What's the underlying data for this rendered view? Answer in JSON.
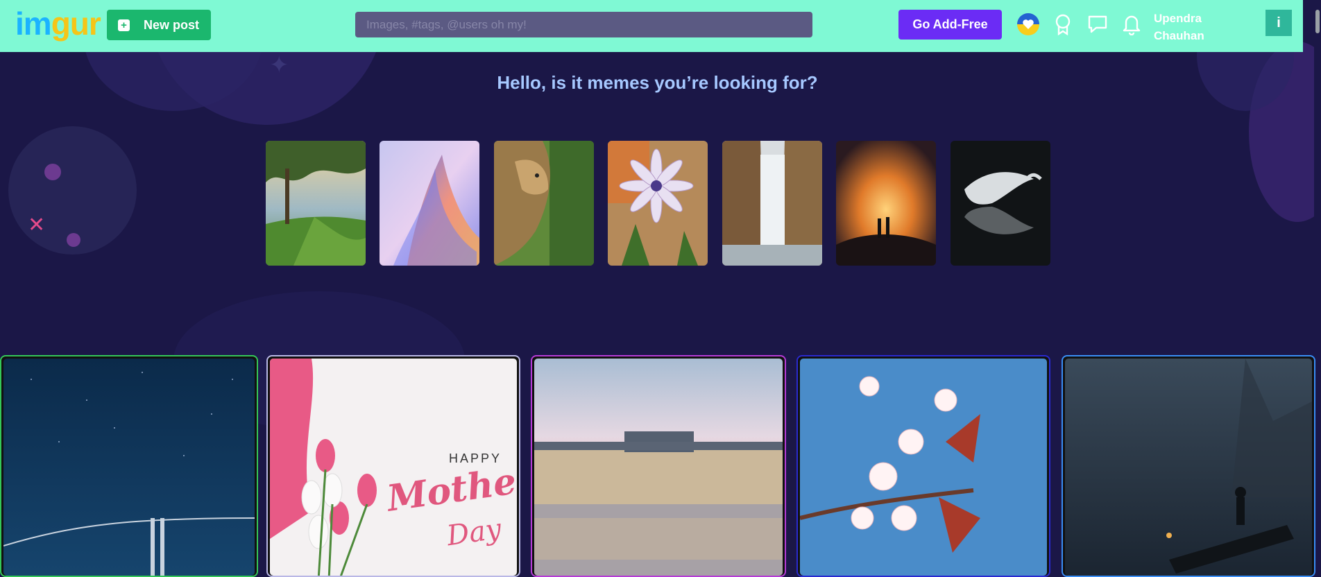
{
  "header": {
    "logo_part1": "im",
    "logo_part2": "gur",
    "new_post_label": "New post",
    "search_placeholder": "Images, #tags, @users oh my!",
    "go_ad_free_label": "Go Add-Free",
    "user_first": "Upendra",
    "user_last": "Chauhan",
    "avatar_initial": "i"
  },
  "hero": {
    "title": "Hello, is it memes you’re looking for?",
    "thumbnails": [
      {
        "name": "beach-tree"
      },
      {
        "name": "abstract-swirl"
      },
      {
        "name": "lion"
      },
      {
        "name": "daisy-flowers"
      },
      {
        "name": "waterfall"
      },
      {
        "name": "sunset-couple"
      },
      {
        "name": "swan"
      }
    ]
  },
  "cards": [
    {
      "name": "night-bridge",
      "border_color": "#34c759"
    },
    {
      "name": "mothers-day",
      "border_color": "#b9b7e6",
      "text_top": "HAPPY",
      "text_main": "Mother's",
      "text_sub": "Day"
    },
    {
      "name": "palace-reflection",
      "border_color": "#b63bd6"
    },
    {
      "name": "cherry-blossom",
      "border_color": "#2a2ad0"
    },
    {
      "name": "fisherman",
      "border_color": "#3a8ef5"
    }
  ],
  "colors": {
    "topbar": "#7ff9d4",
    "background": "#1b1747",
    "new_post": "#1bb76e",
    "go_ad_free": "#6b2cf5",
    "hero_title": "#a6c8ff"
  },
  "icons": [
    "ukraine-heart-icon",
    "award-icon",
    "chat-icon",
    "bell-icon"
  ]
}
